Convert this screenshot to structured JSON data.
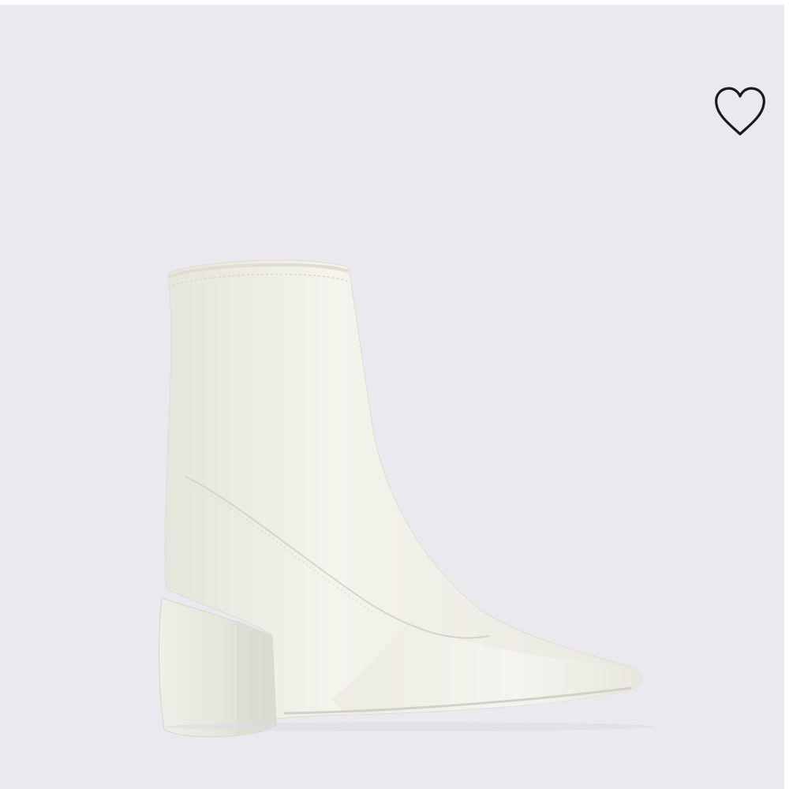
{
  "product_image": {
    "background_color": "#ebe9ed",
    "boot_color": "#f1f0e8",
    "icon": "boot-image"
  },
  "wishlist": {
    "icon": "heart-outline-icon",
    "aria_label": "Add to wishlist",
    "stroke_color": "#1a1a1a"
  }
}
